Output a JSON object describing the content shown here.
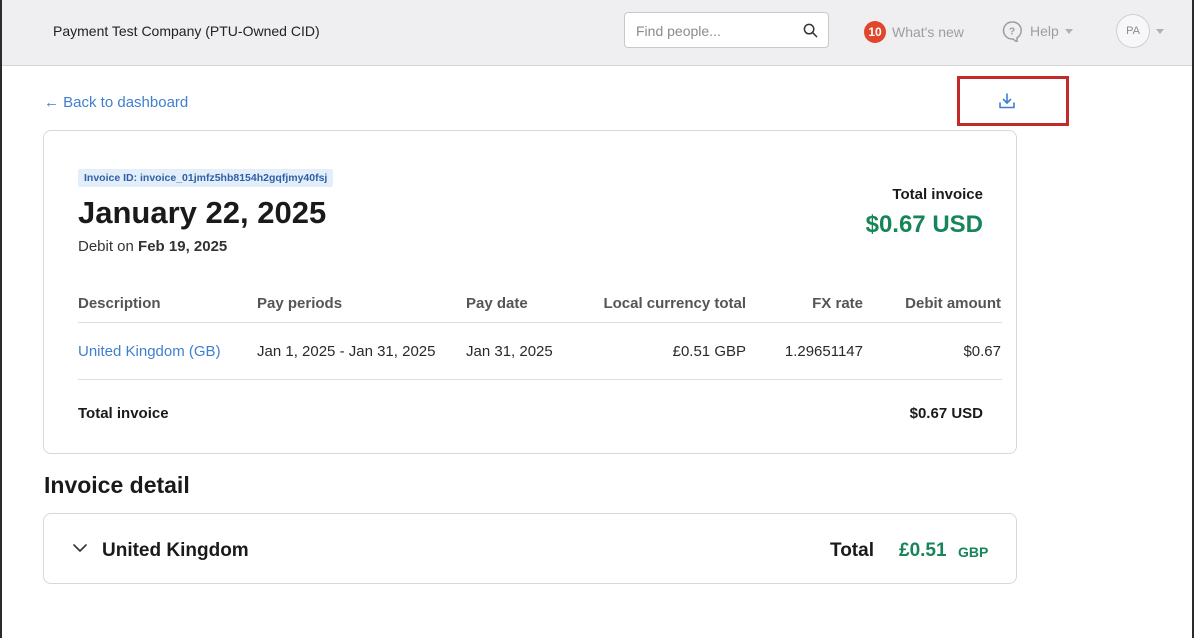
{
  "header": {
    "company": "Payment Test Company (PTU-Owned CID)",
    "search_placeholder": "Find people...",
    "whats_new_count": "10",
    "whats_new_label": "What's new",
    "help_label": "Help",
    "avatar_initials": "PA"
  },
  "nav": {
    "back_label": "← Back to dashboard"
  },
  "invoice": {
    "id_label": "Invoice ID: invoice_01jmfz5hb8154h2gqfjmy40fsj",
    "date": "January 22, 2025",
    "debit_prefix": "Debit on ",
    "debit_date": "Feb 19, 2025",
    "total_label": "Total invoice",
    "total_amount": "$0.67 USD",
    "columns": [
      "Description",
      "Pay periods",
      "Pay date",
      "Local currency total",
      "FX rate",
      "Debit amount"
    ],
    "rows": [
      {
        "description": "United Kingdom (GB)",
        "pay_periods": "Jan 1, 2025 - Jan 31, 2025",
        "pay_date": "Jan 31, 2025",
        "local_total": "£0.51 GBP",
        "fx_rate": "1.29651147",
        "debit_amount": "$0.67"
      }
    ],
    "footer_label": "Total invoice",
    "footer_amount": "$0.67 USD"
  },
  "detail": {
    "title": "Invoice detail",
    "country": "United Kingdom",
    "total_label": "Total",
    "total_amount": "£0.51",
    "total_currency": "GBP"
  },
  "colors": {
    "accent_link": "#3f7fd1",
    "money_green": "#17845a",
    "badge_red": "#e0462b",
    "highlight_red": "#c32a2a"
  }
}
